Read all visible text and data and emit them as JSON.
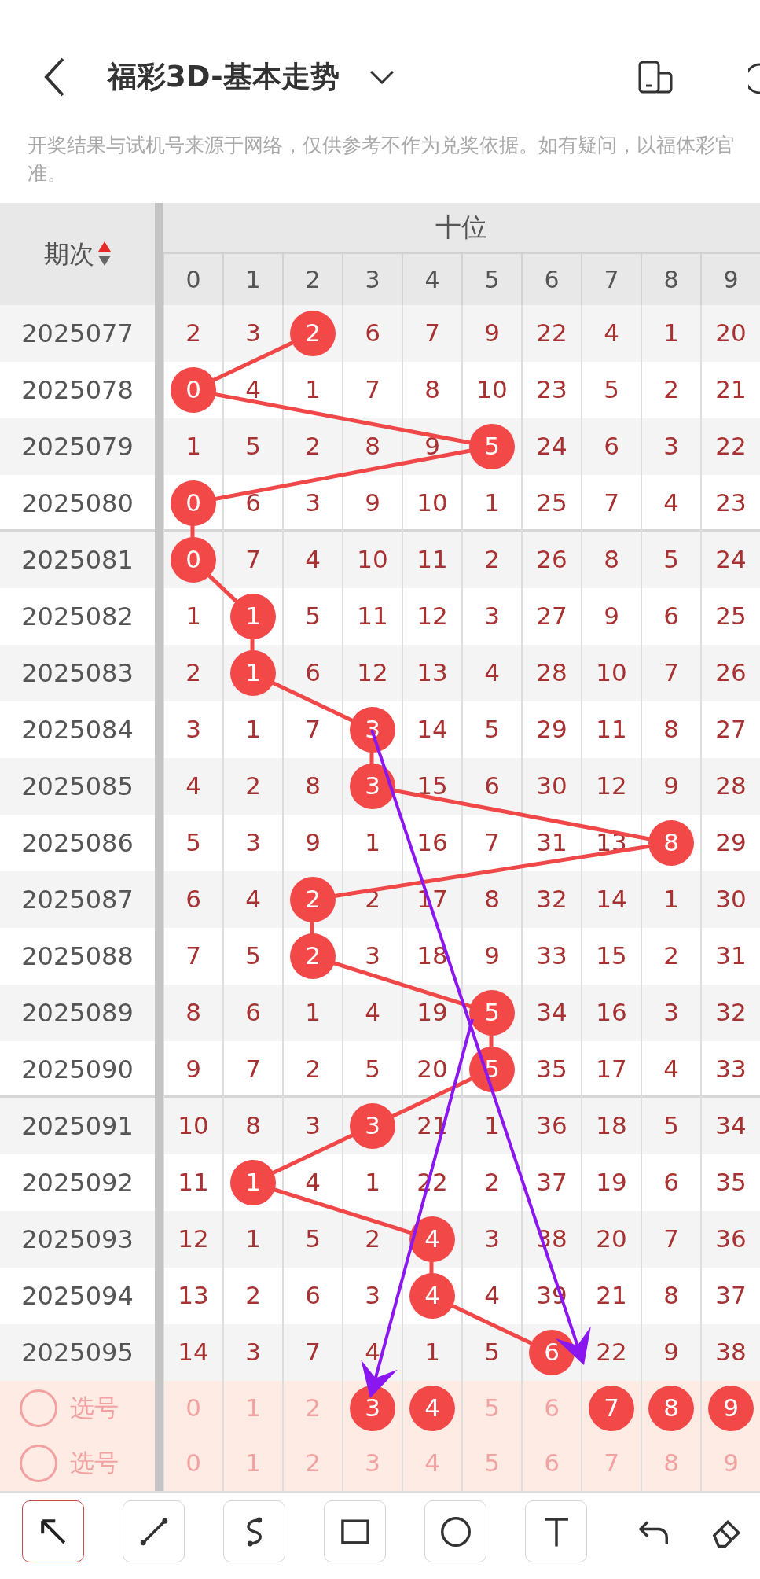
{
  "header": {
    "title": "福彩3D-基本走势"
  },
  "notice": "开奖结果与试机号来源于网络，仅供参考不作为兑奖依据。如有疑问，以福体彩官准。",
  "table": {
    "period_header": "期次",
    "group_header": "十位",
    "digits": [
      "0",
      "1",
      "2",
      "3",
      "4",
      "5",
      "6",
      "7",
      "8",
      "9"
    ],
    "rows": [
      {
        "period": "2025077",
        "cells": [
          {
            "text": "2",
            "hit": false
          },
          {
            "text": "3",
            "hit": false
          },
          {
            "text": "2",
            "hit": true
          },
          {
            "text": "6",
            "hit": false
          },
          {
            "text": "7",
            "hit": false
          },
          {
            "text": "9",
            "hit": false
          },
          {
            "text": "22",
            "hit": false
          },
          {
            "text": "4",
            "hit": false
          },
          {
            "text": "1",
            "hit": false
          },
          {
            "text": "20",
            "hit": false
          }
        ]
      },
      {
        "period": "2025078",
        "cells": [
          {
            "text": "0",
            "hit": true
          },
          {
            "text": "4",
            "hit": false
          },
          {
            "text": "1",
            "hit": false
          },
          {
            "text": "7",
            "hit": false
          },
          {
            "text": "8",
            "hit": false
          },
          {
            "text": "10",
            "hit": false
          },
          {
            "text": "23",
            "hit": false
          },
          {
            "text": "5",
            "hit": false
          },
          {
            "text": "2",
            "hit": false
          },
          {
            "text": "21",
            "hit": false
          }
        ]
      },
      {
        "period": "2025079",
        "cells": [
          {
            "text": "1",
            "hit": false
          },
          {
            "text": "5",
            "hit": false
          },
          {
            "text": "2",
            "hit": false
          },
          {
            "text": "8",
            "hit": false
          },
          {
            "text": "9",
            "hit": false
          },
          {
            "text": "5",
            "hit": true
          },
          {
            "text": "24",
            "hit": false
          },
          {
            "text": "6",
            "hit": false
          },
          {
            "text": "3",
            "hit": false
          },
          {
            "text": "22",
            "hit": false
          }
        ]
      },
      {
        "period": "2025080",
        "cells": [
          {
            "text": "0",
            "hit": true
          },
          {
            "text": "6",
            "hit": false
          },
          {
            "text": "3",
            "hit": false
          },
          {
            "text": "9",
            "hit": false
          },
          {
            "text": "10",
            "hit": false
          },
          {
            "text": "1",
            "hit": false
          },
          {
            "text": "25",
            "hit": false
          },
          {
            "text": "7",
            "hit": false
          },
          {
            "text": "4",
            "hit": false
          },
          {
            "text": "23",
            "hit": false
          }
        ]
      },
      {
        "period": "2025081",
        "cells": [
          {
            "text": "0",
            "hit": true
          },
          {
            "text": "7",
            "hit": false
          },
          {
            "text": "4",
            "hit": false
          },
          {
            "text": "10",
            "hit": false
          },
          {
            "text": "11",
            "hit": false
          },
          {
            "text": "2",
            "hit": false
          },
          {
            "text": "26",
            "hit": false
          },
          {
            "text": "8",
            "hit": false
          },
          {
            "text": "5",
            "hit": false
          },
          {
            "text": "24",
            "hit": false
          }
        ]
      },
      {
        "period": "2025082",
        "cells": [
          {
            "text": "1",
            "hit": false
          },
          {
            "text": "1",
            "hit": true
          },
          {
            "text": "5",
            "hit": false
          },
          {
            "text": "11",
            "hit": false
          },
          {
            "text": "12",
            "hit": false
          },
          {
            "text": "3",
            "hit": false
          },
          {
            "text": "27",
            "hit": false
          },
          {
            "text": "9",
            "hit": false
          },
          {
            "text": "6",
            "hit": false
          },
          {
            "text": "25",
            "hit": false
          }
        ]
      },
      {
        "period": "2025083",
        "cells": [
          {
            "text": "2",
            "hit": false
          },
          {
            "text": "1",
            "hit": true
          },
          {
            "text": "6",
            "hit": false
          },
          {
            "text": "12",
            "hit": false
          },
          {
            "text": "13",
            "hit": false
          },
          {
            "text": "4",
            "hit": false
          },
          {
            "text": "28",
            "hit": false
          },
          {
            "text": "10",
            "hit": false
          },
          {
            "text": "7",
            "hit": false
          },
          {
            "text": "26",
            "hit": false
          }
        ]
      },
      {
        "period": "2025084",
        "cells": [
          {
            "text": "3",
            "hit": false
          },
          {
            "text": "1",
            "hit": false
          },
          {
            "text": "7",
            "hit": false
          },
          {
            "text": "3",
            "hit": true
          },
          {
            "text": "14",
            "hit": false
          },
          {
            "text": "5",
            "hit": false
          },
          {
            "text": "29",
            "hit": false
          },
          {
            "text": "11",
            "hit": false
          },
          {
            "text": "8",
            "hit": false
          },
          {
            "text": "27",
            "hit": false
          }
        ]
      },
      {
        "period": "2025085",
        "cells": [
          {
            "text": "4",
            "hit": false
          },
          {
            "text": "2",
            "hit": false
          },
          {
            "text": "8",
            "hit": false
          },
          {
            "text": "3",
            "hit": true
          },
          {
            "text": "15",
            "hit": false
          },
          {
            "text": "6",
            "hit": false
          },
          {
            "text": "30",
            "hit": false
          },
          {
            "text": "12",
            "hit": false
          },
          {
            "text": "9",
            "hit": false
          },
          {
            "text": "28",
            "hit": false
          }
        ]
      },
      {
        "period": "2025086",
        "cells": [
          {
            "text": "5",
            "hit": false
          },
          {
            "text": "3",
            "hit": false
          },
          {
            "text": "9",
            "hit": false
          },
          {
            "text": "1",
            "hit": false
          },
          {
            "text": "16",
            "hit": false
          },
          {
            "text": "7",
            "hit": false
          },
          {
            "text": "31",
            "hit": false
          },
          {
            "text": "13",
            "hit": false
          },
          {
            "text": "8",
            "hit": true
          },
          {
            "text": "29",
            "hit": false
          }
        ]
      },
      {
        "period": "2025087",
        "cells": [
          {
            "text": "6",
            "hit": false
          },
          {
            "text": "4",
            "hit": false
          },
          {
            "text": "2",
            "hit": true
          },
          {
            "text": "2",
            "hit": false
          },
          {
            "text": "17",
            "hit": false
          },
          {
            "text": "8",
            "hit": false
          },
          {
            "text": "32",
            "hit": false
          },
          {
            "text": "14",
            "hit": false
          },
          {
            "text": "1",
            "hit": false
          },
          {
            "text": "30",
            "hit": false
          }
        ]
      },
      {
        "period": "2025088",
        "cells": [
          {
            "text": "7",
            "hit": false
          },
          {
            "text": "5",
            "hit": false
          },
          {
            "text": "2",
            "hit": true
          },
          {
            "text": "3",
            "hit": false
          },
          {
            "text": "18",
            "hit": false
          },
          {
            "text": "9",
            "hit": false
          },
          {
            "text": "33",
            "hit": false
          },
          {
            "text": "15",
            "hit": false
          },
          {
            "text": "2",
            "hit": false
          },
          {
            "text": "31",
            "hit": false
          }
        ]
      },
      {
        "period": "2025089",
        "cells": [
          {
            "text": "8",
            "hit": false
          },
          {
            "text": "6",
            "hit": false
          },
          {
            "text": "1",
            "hit": false
          },
          {
            "text": "4",
            "hit": false
          },
          {
            "text": "19",
            "hit": false
          },
          {
            "text": "5",
            "hit": true
          },
          {
            "text": "34",
            "hit": false
          },
          {
            "text": "16",
            "hit": false
          },
          {
            "text": "3",
            "hit": false
          },
          {
            "text": "32",
            "hit": false
          }
        ]
      },
      {
        "period": "2025090",
        "cells": [
          {
            "text": "9",
            "hit": false
          },
          {
            "text": "7",
            "hit": false
          },
          {
            "text": "2",
            "hit": false
          },
          {
            "text": "5",
            "hit": false
          },
          {
            "text": "20",
            "hit": false
          },
          {
            "text": "5",
            "hit": true
          },
          {
            "text": "35",
            "hit": false
          },
          {
            "text": "17",
            "hit": false
          },
          {
            "text": "4",
            "hit": false
          },
          {
            "text": "33",
            "hit": false
          }
        ]
      },
      {
        "period": "2025091",
        "cells": [
          {
            "text": "10",
            "hit": false
          },
          {
            "text": "8",
            "hit": false
          },
          {
            "text": "3",
            "hit": false
          },
          {
            "text": "3",
            "hit": true
          },
          {
            "text": "21",
            "hit": false
          },
          {
            "text": "1",
            "hit": false
          },
          {
            "text": "36",
            "hit": false
          },
          {
            "text": "18",
            "hit": false
          },
          {
            "text": "5",
            "hit": false
          },
          {
            "text": "34",
            "hit": false
          }
        ]
      },
      {
        "period": "2025092",
        "cells": [
          {
            "text": "11",
            "hit": false
          },
          {
            "text": "1",
            "hit": true
          },
          {
            "text": "4",
            "hit": false
          },
          {
            "text": "1",
            "hit": false
          },
          {
            "text": "22",
            "hit": false
          },
          {
            "text": "2",
            "hit": false
          },
          {
            "text": "37",
            "hit": false
          },
          {
            "text": "19",
            "hit": false
          },
          {
            "text": "6",
            "hit": false
          },
          {
            "text": "35",
            "hit": false
          }
        ]
      },
      {
        "period": "2025093",
        "cells": [
          {
            "text": "12",
            "hit": false
          },
          {
            "text": "1",
            "hit": false
          },
          {
            "text": "5",
            "hit": false
          },
          {
            "text": "2",
            "hit": false
          },
          {
            "text": "4",
            "hit": true
          },
          {
            "text": "3",
            "hit": false
          },
          {
            "text": "38",
            "hit": false
          },
          {
            "text": "20",
            "hit": false
          },
          {
            "text": "7",
            "hit": false
          },
          {
            "text": "36",
            "hit": false
          }
        ]
      },
      {
        "period": "2025094",
        "cells": [
          {
            "text": "13",
            "hit": false
          },
          {
            "text": "2",
            "hit": false
          },
          {
            "text": "6",
            "hit": false
          },
          {
            "text": "3",
            "hit": false
          },
          {
            "text": "4",
            "hit": true
          },
          {
            "text": "4",
            "hit": false
          },
          {
            "text": "39",
            "hit": false
          },
          {
            "text": "21",
            "hit": false
          },
          {
            "text": "8",
            "hit": false
          },
          {
            "text": "37",
            "hit": false
          }
        ]
      },
      {
        "period": "2025095",
        "cells": [
          {
            "text": "14",
            "hit": false
          },
          {
            "text": "3",
            "hit": false
          },
          {
            "text": "7",
            "hit": false
          },
          {
            "text": "4",
            "hit": false
          },
          {
            "text": "1",
            "hit": false
          },
          {
            "text": "5",
            "hit": false
          },
          {
            "text": "6",
            "hit": true
          },
          {
            "text": "22",
            "hit": false
          },
          {
            "text": "9",
            "hit": false
          },
          {
            "text": "38",
            "hit": false
          }
        ]
      }
    ],
    "pick_rows": [
      {
        "label": "选号",
        "checked": false,
        "numbers": [
          {
            "text": "0",
            "selected": false
          },
          {
            "text": "1",
            "selected": false
          },
          {
            "text": "2",
            "selected": false
          },
          {
            "text": "3",
            "selected": true
          },
          {
            "text": "4",
            "selected": true
          },
          {
            "text": "5",
            "selected": false
          },
          {
            "text": "6",
            "selected": false
          },
          {
            "text": "7",
            "selected": true
          },
          {
            "text": "8",
            "selected": true
          },
          {
            "text": "9",
            "selected": true
          }
        ]
      },
      {
        "label": "选号",
        "checked": false,
        "numbers": [
          {
            "text": "0",
            "selected": false
          },
          {
            "text": "1",
            "selected": false
          },
          {
            "text": "2",
            "selected": false
          },
          {
            "text": "3",
            "selected": false
          },
          {
            "text": "4",
            "selected": false
          },
          {
            "text": "5",
            "selected": false
          },
          {
            "text": "6",
            "selected": false
          },
          {
            "text": "7",
            "selected": false
          },
          {
            "text": "8",
            "selected": false
          },
          {
            "text": "9",
            "selected": false
          }
        ]
      }
    ]
  },
  "tools": [
    {
      "kind": "arrow",
      "selected": true
    },
    {
      "kind": "line",
      "selected": false
    },
    {
      "kind": "curve",
      "selected": false
    },
    {
      "kind": "rectangle",
      "selected": false
    },
    {
      "kind": "circle",
      "selected": false
    },
    {
      "kind": "text",
      "selected": false
    },
    {
      "kind": "undo",
      "selected": false
    },
    {
      "kind": "eraser",
      "selected": false
    }
  ]
}
